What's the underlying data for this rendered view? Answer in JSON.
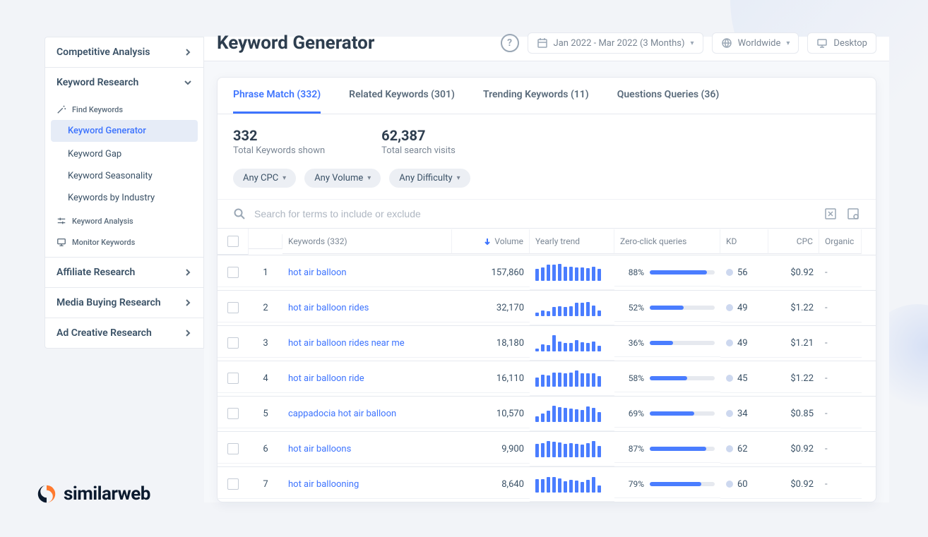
{
  "sidebar": {
    "sections": [
      {
        "label": "Competitive Analysis"
      },
      {
        "label": "Keyword Research"
      }
    ],
    "find_keywords_label": "Find Keywords",
    "items": [
      {
        "label": "Keyword Generator"
      },
      {
        "label": "Keyword Gap"
      },
      {
        "label": "Keyword Seasonality"
      },
      {
        "label": "Keywords by Industry"
      }
    ],
    "keyword_analysis_label": "Keyword Analysis",
    "monitor_label": "Monitor Keywords",
    "bottom_sections": [
      {
        "label": "Affiliate Research"
      },
      {
        "label": "Media Buying Research"
      },
      {
        "label": "Ad Creative Research"
      }
    ]
  },
  "header": {
    "title": "Keyword Generator",
    "date_label": "Jan 2022 - Mar 2022 (3 Months)",
    "region_label": "Worldwide",
    "device_label": "Desktop"
  },
  "tabs": [
    {
      "label": "Phrase Match (332)"
    },
    {
      "label": "Related Keywords (301)"
    },
    {
      "label": "Trending Keywords (11)"
    },
    {
      "label": "Questions Queries (36)"
    }
  ],
  "stats": {
    "total_keywords_num": "332",
    "total_keywords_lbl": "Total Keywords shown",
    "total_visits_num": "62,387",
    "total_visits_lbl": "Total search visits"
  },
  "chips": [
    {
      "label": "Any CPC"
    },
    {
      "label": "Any Volume"
    },
    {
      "label": "Any Difficulty"
    }
  ],
  "search_placeholder": "Search for terms to include or exclude",
  "columns": {
    "keywords": "Keywords (332)",
    "volume": "Volume",
    "trend": "Yearly trend",
    "zero": "Zero-click queries",
    "kd": "KD",
    "cpc": "CPC",
    "organic": "Organic"
  },
  "rows": [
    {
      "rank": "1",
      "kw": "hot air balloon",
      "vol": "157,860",
      "spark": [
        70,
        80,
        95,
        95,
        100,
        85,
        82,
        80,
        78,
        75,
        85,
        72
      ],
      "zc_pct": 88,
      "zc_txt": "88%",
      "kd": "56",
      "cpc": "$0.92",
      "org": "-"
    },
    {
      "rank": "2",
      "kw": "hot air balloon rides",
      "vol": "32,170",
      "spark": [
        20,
        35,
        30,
        55,
        60,
        55,
        60,
        78,
        80,
        85,
        62,
        35
      ],
      "zc_pct": 52,
      "zc_txt": "52%",
      "kd": "49",
      "cpc": "$1.22",
      "org": "-"
    },
    {
      "rank": "3",
      "kw": "hot air balloon rides near me",
      "vol": "18,180",
      "spark": [
        18,
        40,
        36,
        95,
        58,
        52,
        48,
        68,
        55,
        48,
        60,
        35
      ],
      "zc_pct": 36,
      "zc_txt": "36%",
      "kd": "49",
      "cpc": "$1.21",
      "org": "-"
    },
    {
      "rank": "4",
      "kw": "hot air balloon ride",
      "vol": "16,110",
      "spark": [
        55,
        70,
        68,
        85,
        85,
        78,
        82,
        95,
        78,
        80,
        78,
        62
      ],
      "zc_pct": 58,
      "zc_txt": "58%",
      "kd": "45",
      "cpc": "$1.22",
      "org": "-"
    },
    {
      "rank": "5",
      "kw": "cappadocia hot air balloon",
      "vol": "10,570",
      "spark": [
        35,
        52,
        65,
        95,
        88,
        85,
        80,
        75,
        72,
        92,
        85,
        58
      ],
      "zc_pct": 69,
      "zc_txt": "69%",
      "kd": "34",
      "cpc": "$0.85",
      "org": "-"
    },
    {
      "rank": "6",
      "kw": "hot air balloons",
      "vol": "9,900",
      "spark": [
        80,
        82,
        95,
        92,
        88,
        80,
        82,
        78,
        74,
        85,
        95,
        65
      ],
      "zc_pct": 87,
      "zc_txt": "87%",
      "kd": "62",
      "cpc": "$0.92",
      "org": "-"
    },
    {
      "rank": "7",
      "kw": "hot air ballooning",
      "vol": "8,640",
      "spark": [
        78,
        80,
        92,
        92,
        82,
        68,
        75,
        72,
        62,
        74,
        90,
        42
      ],
      "zc_pct": 79,
      "zc_txt": "79%",
      "kd": "60",
      "cpc": "$0.92",
      "org": "-"
    }
  ],
  "brand": "similarweb"
}
